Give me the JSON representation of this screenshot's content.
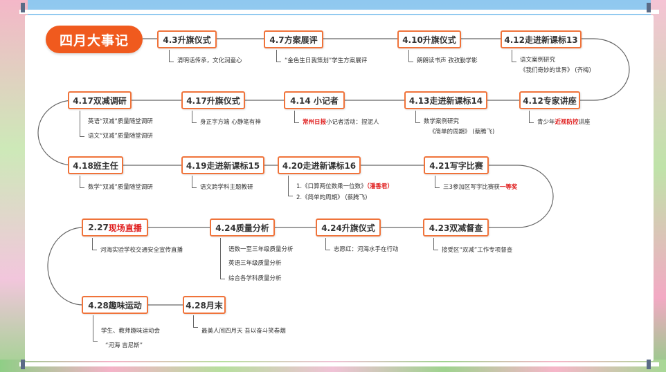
{
  "title": "四月大事记",
  "colors": {
    "accent": "#f05a1e",
    "node_border": "#f0733a",
    "highlight": "#e02020",
    "line": "#666666"
  },
  "nodes": {
    "n1": "4.3升旗仪式",
    "n2": "4.7方案展评",
    "n3": "4.10升旗仪式",
    "n4": "4.12走进新课标13",
    "n5": "4.17双减调研",
    "n6": "4.17升旗仪式",
    "n7": "4.14  小记者",
    "n8": "4.13走进新课标14",
    "n9": "4.12专家讲座",
    "n10": "4.18班主任",
    "n11": "4.19走进新课标15",
    "n12": "4.20走进新课标16",
    "n13": "4.21写字比赛",
    "n14_date": "2.27",
    "n14_red": "现场直播",
    "n15": "4.24质量分析",
    "n16": "4.24升旗仪式",
    "n17": "4.23双减督查",
    "n18": "4.28趣味运动",
    "n19": "4.28月末"
  },
  "descs": {
    "d1": "清明话传承，文化润童心",
    "d2": "“金色生日我策划”学生方案展评",
    "d3": "朗朗读书声  孜孜勤学影",
    "d4a": "语文案例研究",
    "d4b": "《我们奇妙的世界》  (齐梅)",
    "d5a": "英语“双减”质量随堂调研",
    "d5b": "语文“双减”质量随堂调研",
    "d6": "身正字方端 心静笔有神",
    "d7_red": "常州日报",
    "d7_rest": "小记者活动：捏泥人",
    "d8a": "数学案例研究",
    "d8b": "《简单的周期》  (蔡腾飞)",
    "d9_pre": "青少年",
    "d9_red": "近视防控",
    "d9_post": "讲座",
    "d10": "数学“双减”质量随堂调研",
    "d11": "语文跨学科主题教研",
    "d12a_pre": "1.《口算两位数乘一位数》",
    "d12a_red": "（潘香君）",
    "d12b": "2.《简单的周期》  (蔡腾飞)",
    "d13_pre": "三3参加区写字比赛获",
    "d13_red": "一等奖",
    "d14": "河海实验学校交通安全宣传直播",
    "d15a": "语数一至三年级质量分析",
    "d15b": "英语三年级质量分析",
    "d15c": "综合各学科质量分析",
    "d16": "志愿红：河海水手在行动",
    "d17": "接受区“双减”工作专项督查",
    "d18a": "学生、教师趣味运动会",
    "d18b": "“河海 吉尼斯”",
    "d19": "最美人间四月天    吾以奋斗笑春烟"
  }
}
